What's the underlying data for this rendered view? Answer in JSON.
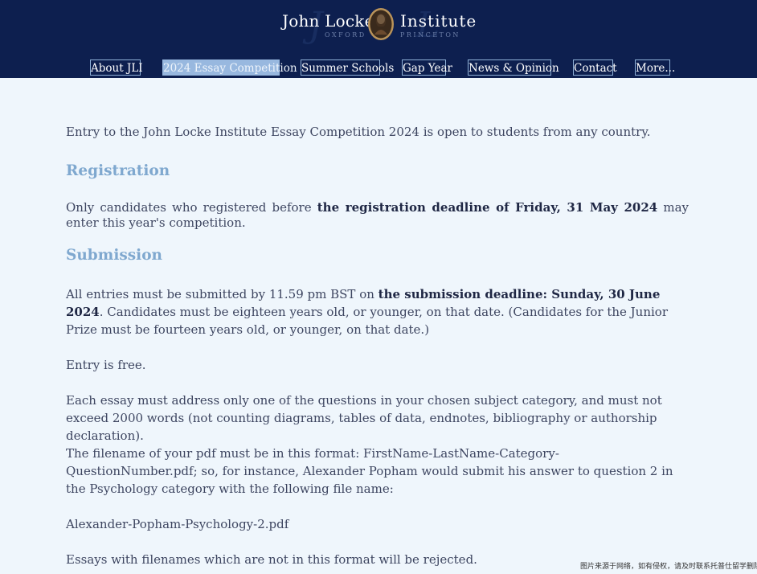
{
  "header": {
    "logo_left": "John Locke",
    "logo_right": "Institute",
    "logo_sub_left": "OXFORD",
    "logo_sub_right": "PRINCETON",
    "nav": [
      {
        "label": "About JLI",
        "active": false
      },
      {
        "label": "2024 Essay Competition",
        "active": true
      },
      {
        "label": "Summer Schools",
        "active": false
      },
      {
        "label": "Gap Year",
        "active": false
      },
      {
        "label": "News & Opinion",
        "active": false
      },
      {
        "label": "Contact",
        "active": false
      },
      {
        "label": "More...",
        "active": false
      }
    ],
    "colors": {
      "background": "#0d1f4f",
      "nav_border": "#8fb1d8",
      "nav_active": "#98b8df"
    }
  },
  "main": {
    "intro": "Entry to the John Locke Institute Essay Competition 2024 is open to students from any country.",
    "registration": {
      "heading": "Registration",
      "text_before": "Only candidates who registered before ",
      "text_bold": "the registration deadline of Friday, 31 May 2024",
      "text_after": " may enter this year's competition."
    },
    "submission": {
      "heading": "Submission",
      "deadline_before": "All entries must be submitted by 11.59 pm BST on ",
      "deadline_bold": "the submission deadline: Sunday, 30 June 2024",
      "deadline_after": ". Candidates must be eighteen years old, or younger, on that date. (Candidates for the Junior Prize must be fourteen years old, or younger, on that date.)",
      "entry_free": "Entry is free.",
      "essay_rule": "Each essay must address only one of the questions in your chosen subject category, and must not exceed 2000 words (not counting diagrams, tables of data, endnotes, bibliography or authorship declaration).",
      "filename_rule": "The filename of your pdf must be in this format: FirstName-LastName-Category-QuestionNumber.pdf; so, for instance, Alexander Popham would submit his answer to question 2 in the Psychology category with the following file name:",
      "filename_example": "Alexander-Popham-Psychology-2.pdf",
      "rejected_note": "Essays with filenames which are not in this format will be rejected."
    },
    "colors": {
      "background": "#eff6fc",
      "heading": "#7fa8cf",
      "text": "#3d4560"
    }
  },
  "footer": {
    "note": "图片来源于网络，如有侵权，请及时联系托普仕留学删除"
  }
}
